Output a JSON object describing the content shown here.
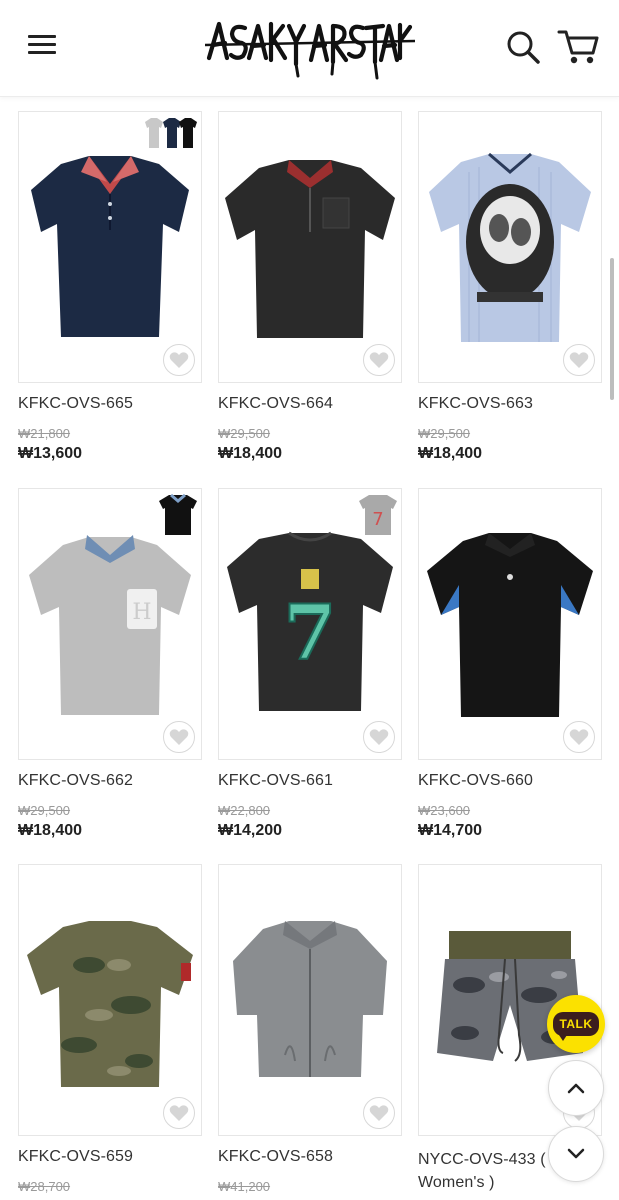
{
  "header": {
    "logo_text": "ASAKY ARSTAKY",
    "menu_icon": "hamburger-menu-icon",
    "search_icon": "search-icon",
    "cart_icon": "shopping-cart-icon"
  },
  "products": [
    {
      "name": "KFKC-OVS-665",
      "original_price": "₩21,800",
      "sale_price": "₩13,600"
    },
    {
      "name": "KFKC-OVS-664",
      "original_price": "₩29,500",
      "sale_price": "₩18,400"
    },
    {
      "name": "KFKC-OVS-663",
      "original_price": "₩29,500",
      "sale_price": "₩18,400"
    },
    {
      "name": "KFKC-OVS-662",
      "original_price": "₩29,500",
      "sale_price": "₩18,400"
    },
    {
      "name": "KFKC-OVS-661",
      "original_price": "₩22,800",
      "sale_price": "₩14,200"
    },
    {
      "name": "KFKC-OVS-660",
      "original_price": "₩23,600",
      "sale_price": "₩14,700"
    },
    {
      "name": "KFKC-OVS-659",
      "original_price": "₩28,700",
      "sale_price": ""
    },
    {
      "name": "KFKC-OVS-658",
      "original_price": "₩41,200",
      "sale_price": ""
    },
    {
      "name": "NYCC-OVS-433 ( Women's )",
      "original_price": "",
      "sale_price": ""
    }
  ],
  "floating": {
    "talk_label": "TALK",
    "scroll_up_icon": "chevron-up-icon",
    "scroll_down_icon": "chevron-down-icon"
  },
  "colors": {
    "talk_yellow": "#fbe100",
    "talk_brown": "#3c1e1e"
  }
}
